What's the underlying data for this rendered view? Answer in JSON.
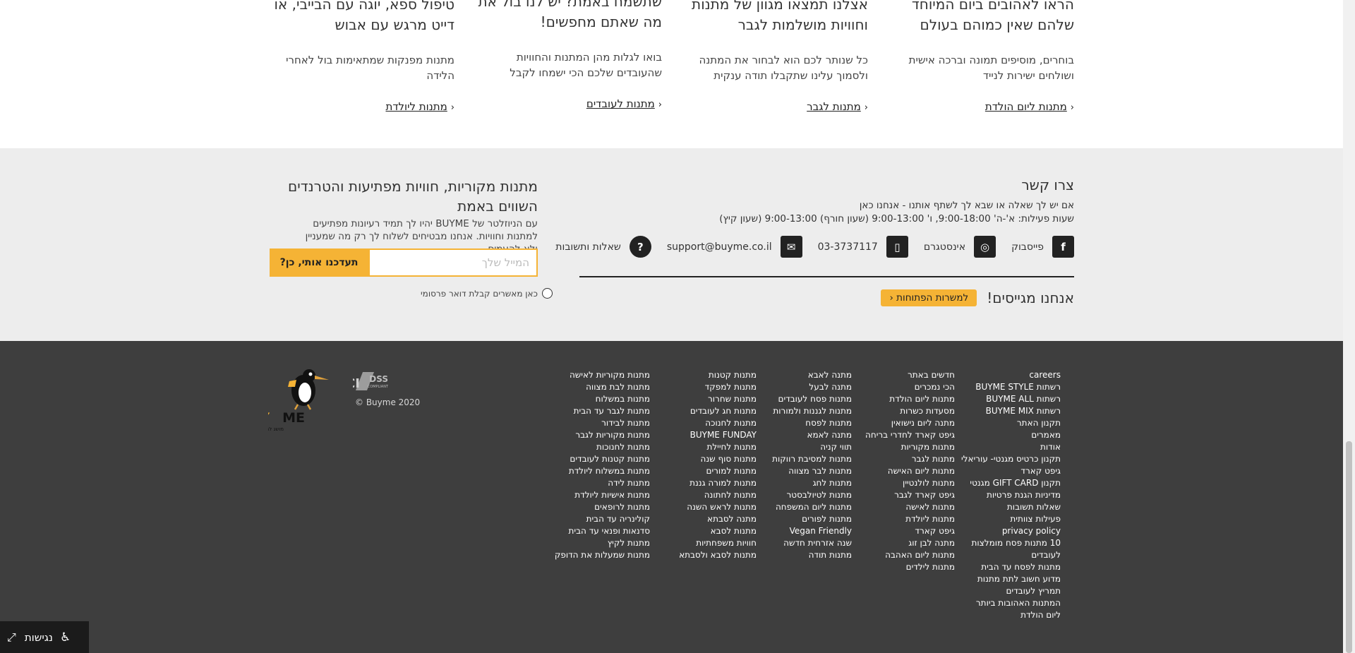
{
  "cards": [
    {
      "title": "הראו לאהובים ביום המיוחד שלהם שאין כמוהם בעולם",
      "description": "בוחרים, מוסיפים תמונה וברכה אישית ושולחים ישירות לנייד",
      "link": "מתנות ליום הולדת"
    },
    {
      "title": "אצלנו תמצאו מגוון של מתנות וחוויות מושלמות לגבר",
      "description": "כל שנותר לכם הוא לבחור את המתנה ולסמוך עלינו שתקבלו תודה ענקית",
      "link": "מתנות לגבר"
    },
    {
      "title": "שתשמח באמת? יש לנו בול את מה שאתם מחפשים!",
      "description": "בואו לגלות מהן המתנות והחוויות שהעובדים שלכם הכי ישמחו לקבל",
      "link": "מתנות לעובדים"
    },
    {
      "title": "טיפול ספא, יוגה עם הבייבי, או דייט מרגש עם אבוש",
      "description": "מתנות מפנקות שמתאימות בול לאחרי הלידה",
      "link": "מתנות ליולדת"
    }
  ],
  "contact": {
    "title": "צרו קשר",
    "line1": "אם יש לך שאלה או שבא לך לשתף אותנו - אנחנו כאן",
    "line2": "שעות פעילות: א'-ה' 9:00-18:00, ו' 9:00-13:00 (שעון חורף) 9:00-13:00 (שעון קיץ)",
    "items": [
      {
        "label": "פייסבוק",
        "icon": "facebook-icon",
        "glyph": "f"
      },
      {
        "label": "אינסטגרם",
        "icon": "instagram-icon",
        "glyph": "◎"
      },
      {
        "label": "03-3737117",
        "icon": "phone-icon",
        "glyph": "▯"
      },
      {
        "label": "support@buyme.co.il",
        "icon": "email-icon",
        "glyph": "✉"
      },
      {
        "label": "שאלות ותשובות",
        "icon": "help-icon",
        "glyph": "?"
      }
    ],
    "hiring_text": "אנחנו מגייסים!",
    "jobs_button": "למשרות הפתוחות"
  },
  "newsletter": {
    "title": "מתנות מקוריות, חוויות מפתיעות והטרנדים השווים באמת",
    "description": "עם הניוזלטר של BUYME יהיו לך תמיד רעיונות מפתיעים למתנות וחוויות. אנחנו מבטיחים לשלוח לך רק מה שמעניין ולא להעמיס.",
    "placeholder": "המייל שלך",
    "button": "תעדכנו אותי, כן?",
    "consent": "כאן מאשרים קבלת דואר פרסומי"
  },
  "footer": {
    "col1": [
      "careers",
      "רשתות BUYME STYLE",
      "רשתות BUYME ALL",
      "רשתות BUYME MIX",
      "תקנון האתר",
      "מאמרים",
      "אודות",
      "תקנון כרטיס מגנטי- עוריאלי",
      "גיפט קארד",
      "תקנון GIFT CARD מגנטי",
      "מדיניות הגנת פרטיות",
      "שאלות תשובות",
      "פעילות צוותית",
      "privacy policy",
      "10 מתנות פסח מומלצות",
      "לעובדים",
      "מתנות לפסח עד הבית",
      "מדוע חשוב לתת מתנות",
      "תמריץ לעובדים",
      "המתנות האהובות ביותר",
      "ליום הולדת"
    ],
    "col2": [
      "חדשים באתר",
      "הכי נמכרים",
      "מתנות ליום הולדת",
      "מסעדות כשרות",
      "מתנה ליום נישואין",
      "גיפט קארד לחדרי בריחה",
      "מתנות מקוריות",
      "מתנות לגבר",
      "מתנות ליום האישה",
      "מתנות לולנטיין",
      "גיפט קארד לגבר",
      "מתנות לאישה",
      "מתנות ליולדת",
      "גיפט קארד",
      "מתנה לבן זוג",
      "מתנות ליום האהבה",
      "מתנות לילדים"
    ],
    "col3": [
      "מתנה לאבא",
      "מתנה לבעל",
      "מתנות פסח לעובדים",
      "מתנות לגננות ולמורות",
      "מתנות לפסח",
      "מתנה לאמא",
      "תווי קניה",
      "מתנות למסיבת רווקות",
      "מתנות לבר מצווה",
      "מתנות לחג",
      "מתנות לטיולבסטר",
      "מתנות ליום המשפחה",
      "מתנות לפורים",
      "Vegan Friendly",
      "שנה אזרחית חדשה",
      "מתנות תודה"
    ],
    "col4": [
      "מתנות קטנות",
      "מתנות למפקד",
      "מתנות שחרור",
      "מתנות חג לעובדים",
      "מתנות לחנוכה",
      "BUYME FUNDAY",
      "מתנות לחיילת",
      "מתנות סוף שנה",
      "מתנות למורים",
      "מתנות למורה גננת",
      "מתנות לחתונה",
      "מתנות לראש השנה",
      "מתנה לסבתא",
      "מתנות לסבא",
      "חוויות משפחתיות",
      "מתנות לסבא ולסבתא"
    ],
    "col5": [
      "מתנות מקוריות לאישה",
      "מתנות לבת מצווה",
      "מתנות במשלוח",
      "מתנות לגבר עד הבית",
      "מתנות לבידור",
      "מתנות מקוריות לגבר",
      "מתנות לחנוכות",
      "מתנות קטנות לעובדים",
      "מתנות במשלוח ליולדת",
      "מתנות לידה",
      "מתנות אישיות ליולדת",
      "מתנות לרופאים",
      "קולינריה עד הבית",
      "סדנאות ופנאי עד הבית",
      "מתנות לקיץ",
      "מתנות שמעלות את הדופק"
    ],
    "copyright": "© Buyme 2020",
    "logo_text": "BUYME",
    "logo_tagline": "מושג לתת מתנות"
  },
  "accessibility": {
    "label": "נגישות"
  },
  "colors": {
    "accent": "#f5b335",
    "footer_bg": "#3e3e3e",
    "gray_bg": "#ededed"
  }
}
